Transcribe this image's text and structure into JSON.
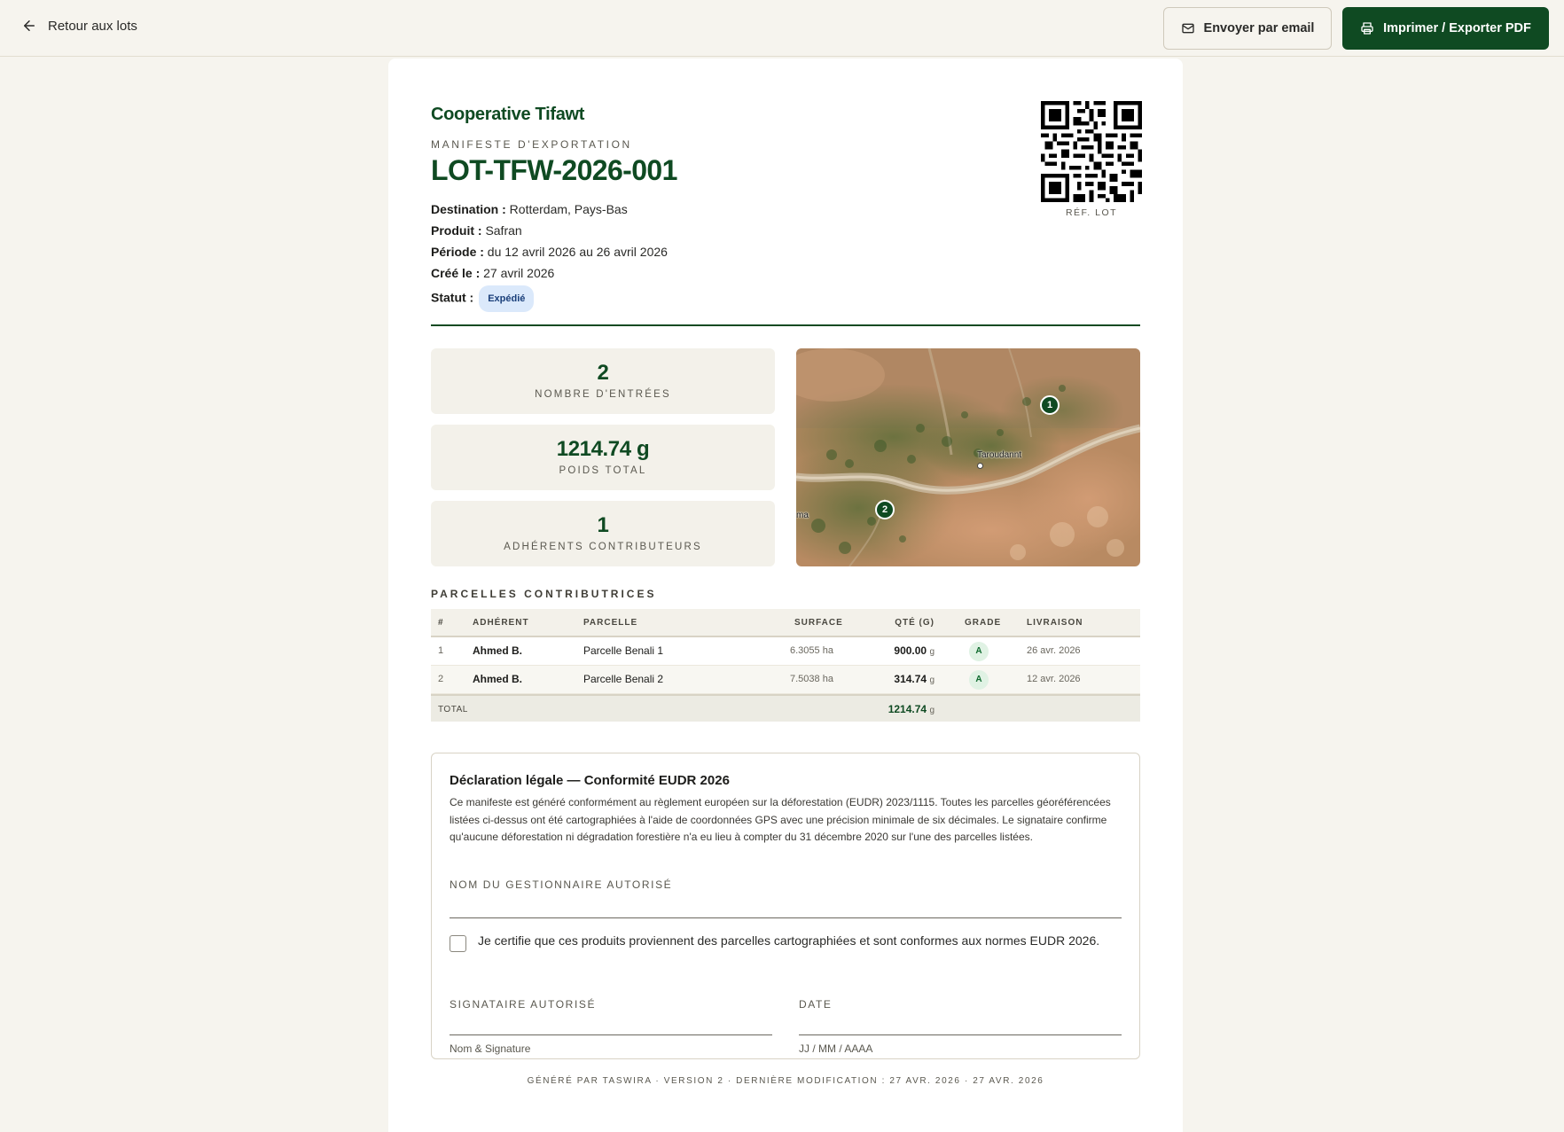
{
  "topbar": {
    "back_label": "Retour aux lots",
    "email_label": "Envoyer par email",
    "print_label": "Imprimer / Exporter PDF"
  },
  "header": {
    "coop_name": "Cooperative Tifawt",
    "doc_type": "MANIFESTE D'EXPORTATION",
    "lot_id": "LOT-TFW-2026-001",
    "destination_label": "Destination :",
    "destination": "Rotterdam, Pays-Bas",
    "product_label": "Produit :",
    "product": "Safran",
    "period_label": "Période :",
    "period": "du 12 avril 2026 au 26 avril 2026",
    "created_label": "Créé le :",
    "created": "27 avril 2026",
    "status_label": "Statut :",
    "status": "Expédié",
    "qr_caption": "RÉF. LOT"
  },
  "stats": [
    {
      "value": "2",
      "label": "NOMBRE D'ENTRÉES"
    },
    {
      "value": "1214.74 g",
      "label": "POIDS TOTAL"
    },
    {
      "value": "1",
      "label": "ADHÉRENTS CONTRIBUTEURS"
    }
  ],
  "map": {
    "town_label": "Taroudannt",
    "edge_label": "ma",
    "markers": [
      "1",
      "2"
    ]
  },
  "parcels": {
    "title": "PARCELLES CONTRIBUTRICES",
    "headers": [
      "#",
      "ADHÉRENT",
      "PARCELLE",
      "SURFACE",
      "QTÉ (G)",
      "GRADE",
      "LIVRAISON"
    ],
    "rows": [
      {
        "n": "1",
        "member": "Ahmed B.",
        "parcel": "Parcelle Benali 1",
        "surface": "6.3055",
        "surface_unit": "ha",
        "qty": "900.00",
        "qty_unit": "g",
        "grade": "A",
        "delivery": "26 avr. 2026"
      },
      {
        "n": "2",
        "member": "Ahmed B.",
        "parcel": "Parcelle Benali 2",
        "surface": "7.5038",
        "surface_unit": "ha",
        "qty": "314.74",
        "qty_unit": "g",
        "grade": "A",
        "delivery": "12 avr. 2026"
      }
    ],
    "total_label": "TOTAL",
    "total_qty": "1214.74",
    "total_unit": "g"
  },
  "declaration": {
    "title": "Déclaration légale — Conformité EUDR 2026",
    "text": "Ce manifeste est généré conformément au règlement européen sur la déforestation (EUDR) 2023/1115. Toutes les parcelles géoréférencées listées ci-dessus ont été cartographiées à l'aide de coordonnées GPS avec une précision minimale de six décimales. Le signataire confirme qu'aucune déforestation ni dégradation forestière n'a eu lieu à compter du 31 décembre 2020 sur l'une des parcelles listées.",
    "manager_label": "NOM DU GESTIONNAIRE AUTORISÉ",
    "manager_value": "",
    "certify_text": "Je certifie que ces produits proviennent des parcelles cartographiées et sont conformes aux normes EUDR 2026.",
    "certify_checked": false,
    "signatory_label": "SIGNATAIRE AUTORISÉ",
    "signatory_placeholder": "Nom & Signature",
    "date_label": "DATE",
    "date_placeholder": "JJ / MM / AAAA"
  },
  "footer": {
    "text": "GÉNÉRÉ PAR TASWIRA · VERSION 2 · DERNIÈRE MODIFICATION : 27 AVR. 2026 · 27 AVR. 2026"
  },
  "colors": {
    "brand_green": "#0f4a22",
    "background": "#f6f4ee",
    "status_badge_bg": "#dbe9fb",
    "grade_badge_bg": "#e0f2e4"
  }
}
